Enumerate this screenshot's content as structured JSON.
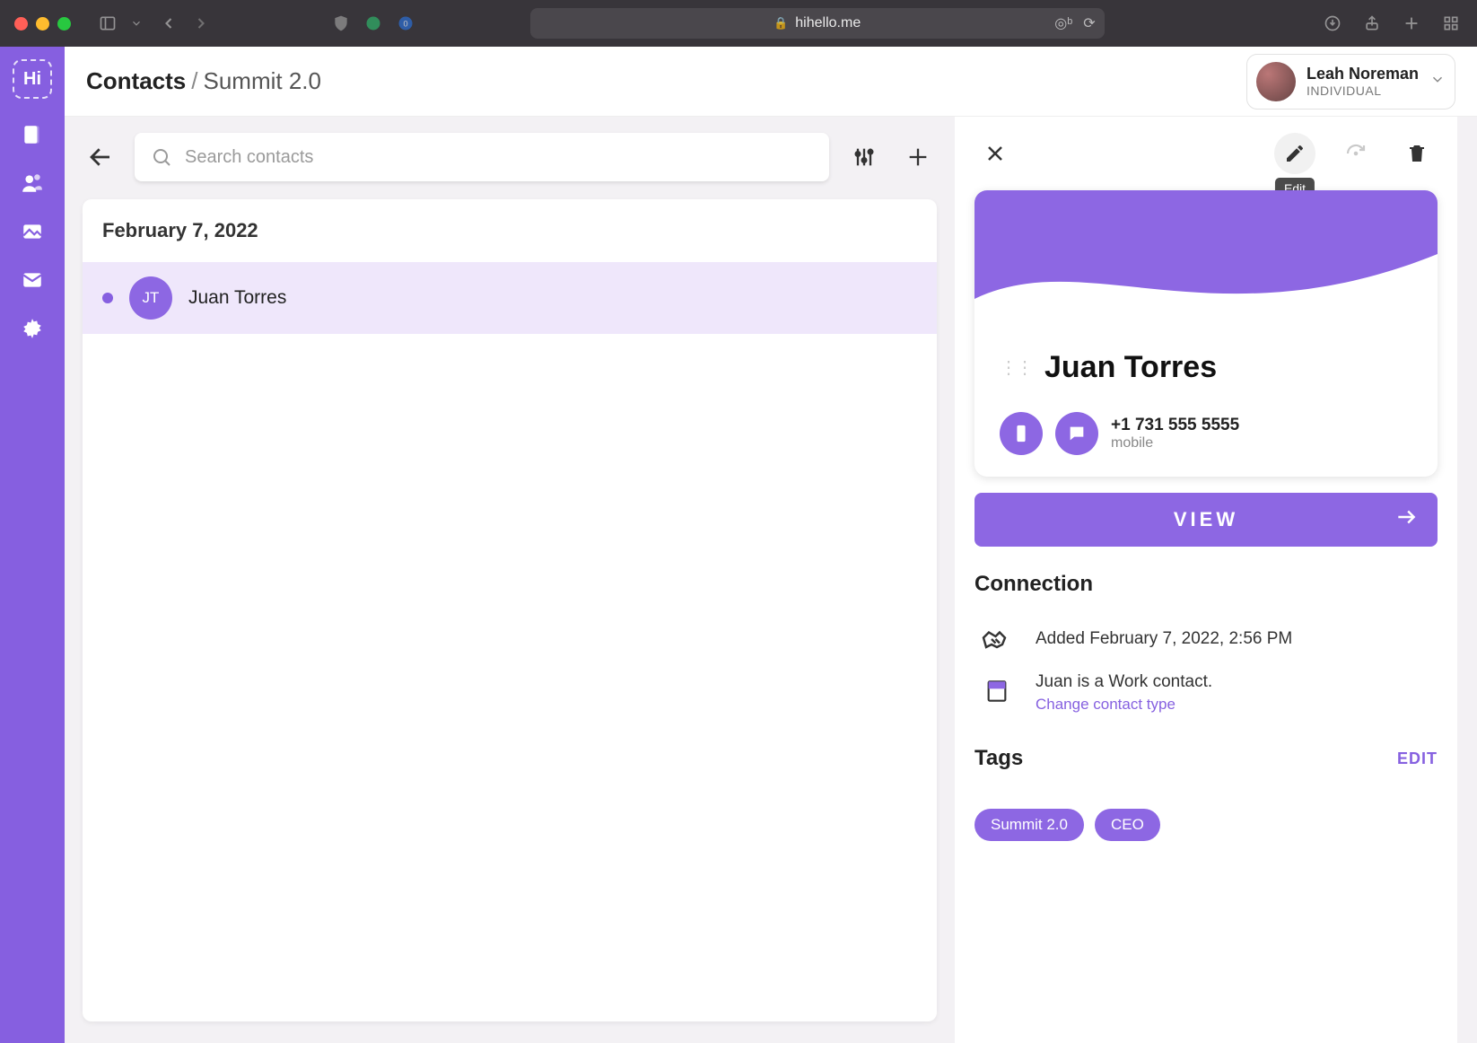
{
  "browser": {
    "url": "hihello.me"
  },
  "user": {
    "name": "Leah Noreman",
    "type": "INDIVIDUAL"
  },
  "breadcrumb": {
    "root": "Contacts",
    "sep": "/",
    "current": "Summit 2.0"
  },
  "search": {
    "placeholder": "Search contacts"
  },
  "list": {
    "date_header": "February 7, 2022",
    "items": [
      {
        "initials": "JT",
        "name": "Juan Torres"
      }
    ]
  },
  "detail": {
    "edit_tooltip": "Edit",
    "name": "Juan Torres",
    "phone": {
      "number": "+1 731 555 5555",
      "type": "mobile"
    },
    "view_label": "VIEW",
    "connection": {
      "heading": "Connection",
      "added": "Added February 7, 2022, 2:56 PM",
      "contact_type_line": "Juan is a Work contact.",
      "change_link": "Change contact type"
    },
    "tags": {
      "heading": "Tags",
      "edit_label": "EDIT",
      "items": [
        "Summit 2.0",
        "CEO"
      ]
    }
  },
  "rail": {
    "logo": "Hi"
  }
}
